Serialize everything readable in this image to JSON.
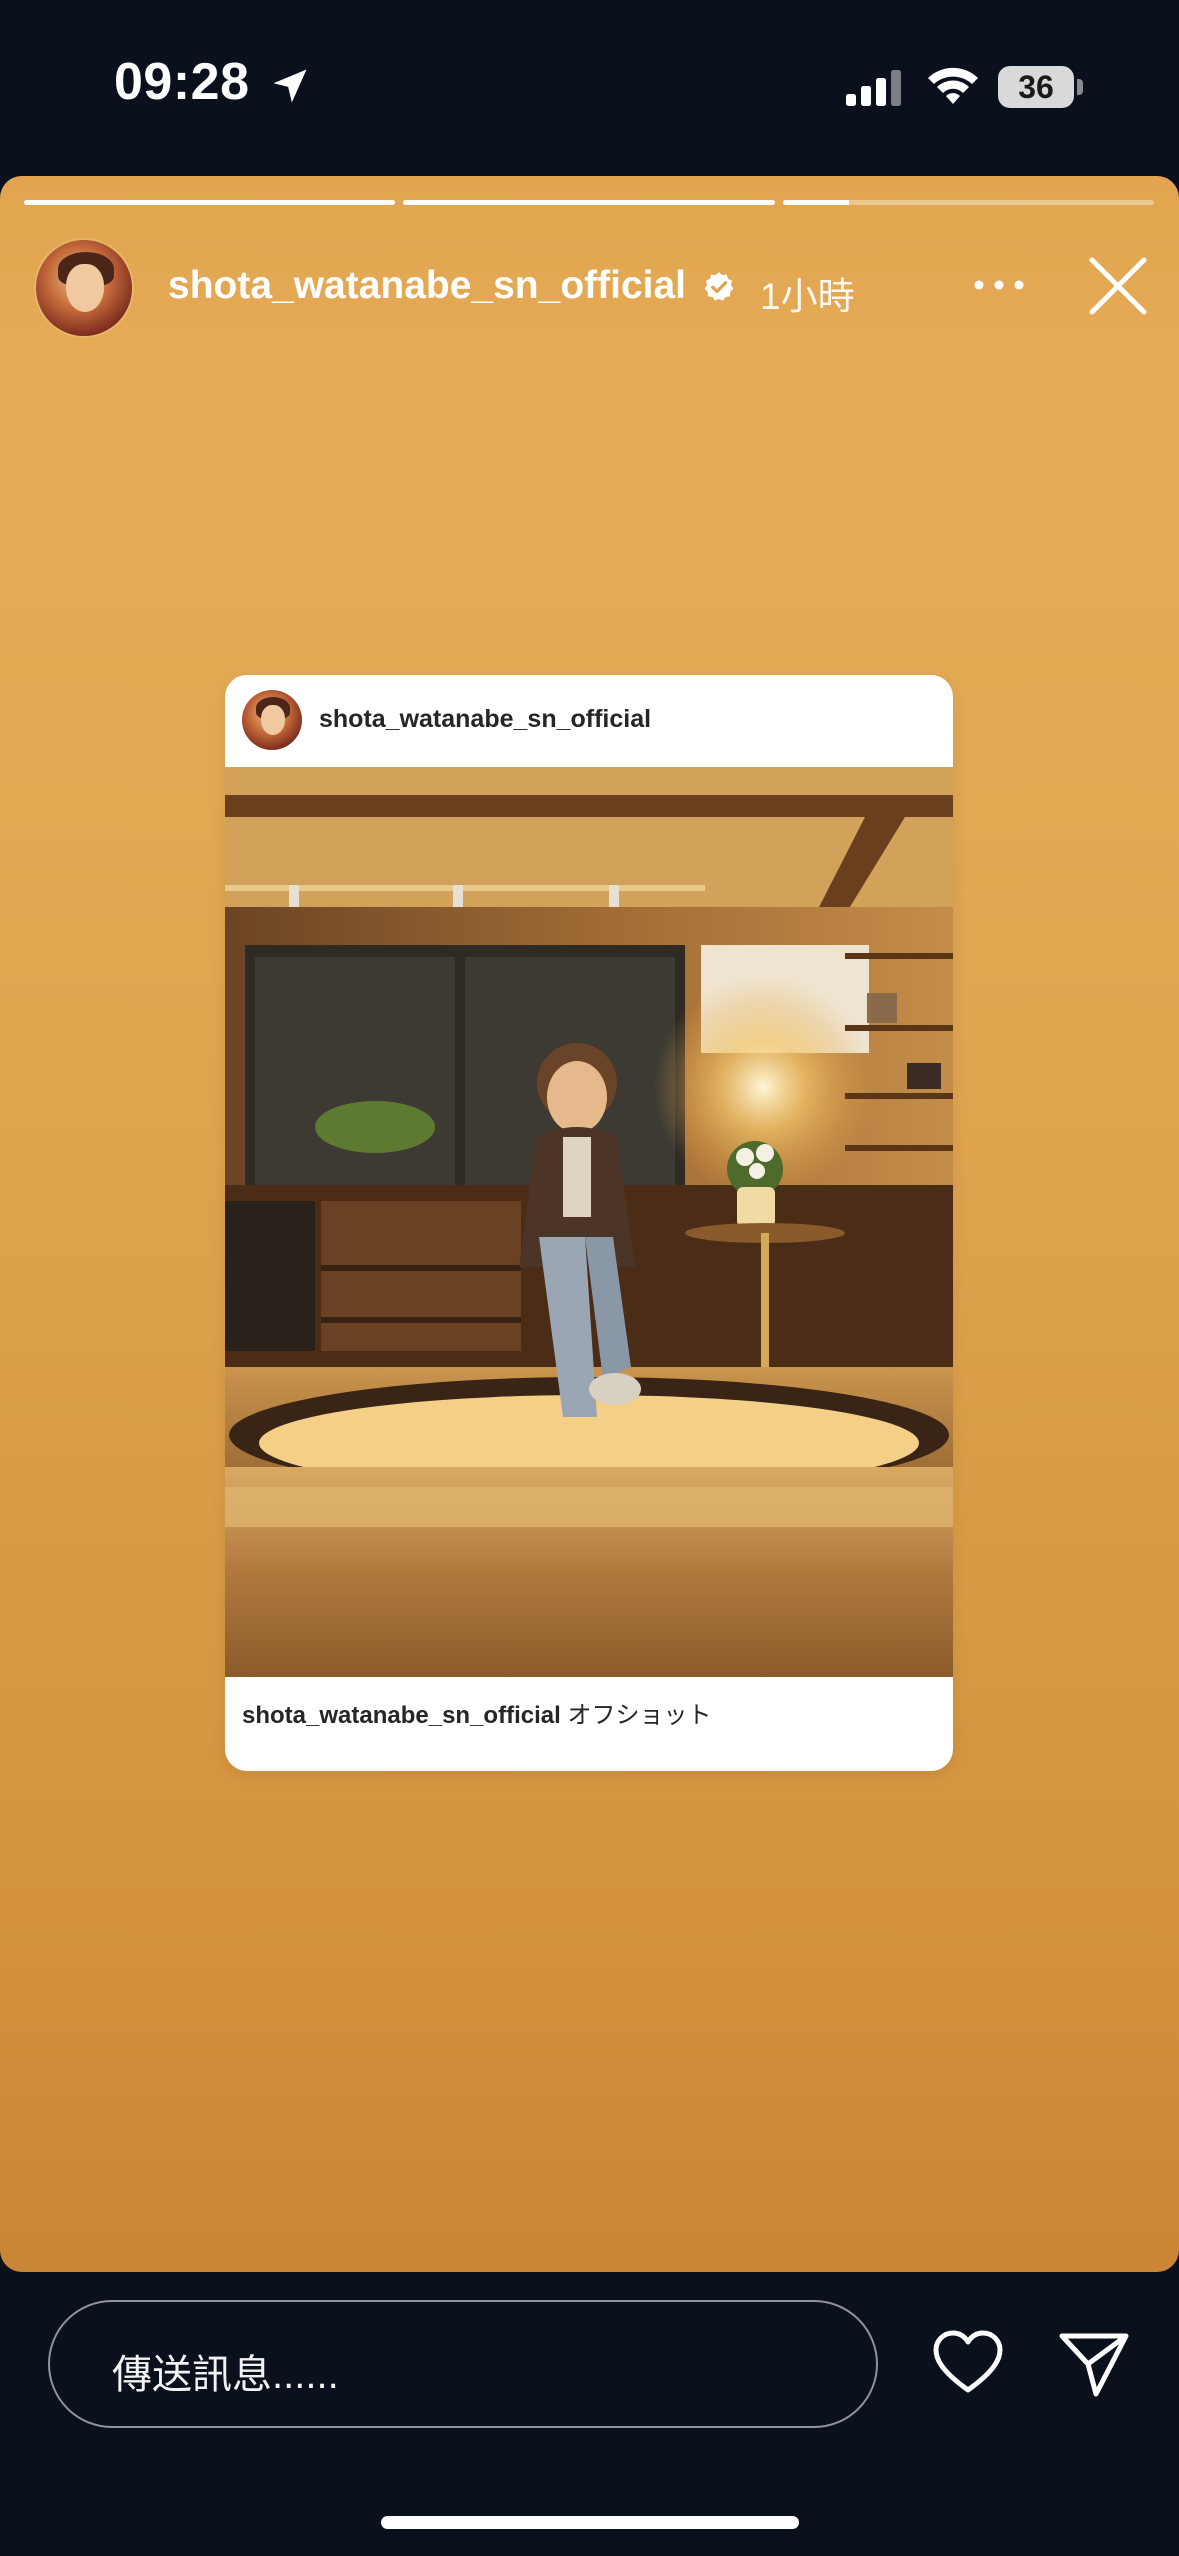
{
  "status_bar": {
    "time": "09:28",
    "battery": "36",
    "icons": [
      "location-arrow-icon",
      "signal-icon",
      "wifi-icon",
      "battery-icon"
    ]
  },
  "story": {
    "progress": [
      1.0,
      1.0,
      0.18
    ],
    "header": {
      "username": "shota_watanabe_sn_official",
      "verified": true,
      "time_ago": "1小時"
    },
    "colors": {
      "background_top": "#e5ad58",
      "background_bottom": "#c98637",
      "chrome": "#0b101d"
    },
    "shared_post": {
      "username": "shota_watanabe_sn_official",
      "caption_user": "shota_watanabe_sn_official",
      "caption_text": "オフショット"
    }
  },
  "reply_bar": {
    "message_placeholder": "傳送訊息......",
    "icons": [
      "heart-icon",
      "send-icon"
    ]
  }
}
